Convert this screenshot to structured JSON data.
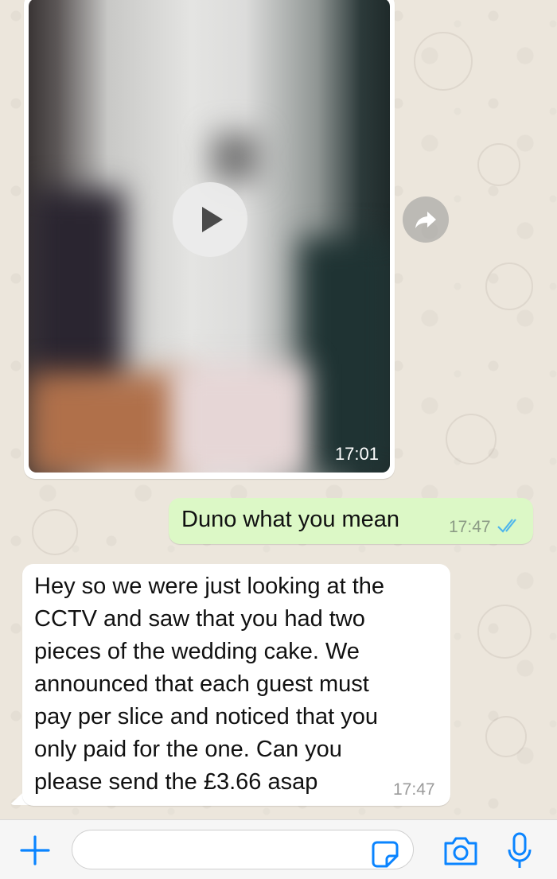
{
  "video_message": {
    "time": "17:01"
  },
  "outgoing_message": {
    "text": "Duno what you mean",
    "time": "17:47"
  },
  "incoming_message": {
    "text": "Hey so we were just looking at the\nCCTV and saw that you had two\npieces of the wedding cake. We\nannounced that each guest must\npay per slice and noticed that you\nonly paid for the one. Can you\nplease send the £3.66 asap",
    "time": "17:47"
  },
  "input_bar": {
    "placeholder": ""
  },
  "colors": {
    "chat_background": "#ece6dc",
    "outgoing_bubble": "#dcf8c6",
    "incoming_bubble": "#ffffff",
    "accent": "#0a84ff",
    "read_ticks": "#4fb6ec"
  },
  "icons": [
    "play-icon",
    "forward-icon",
    "read-ticks-icon",
    "plus-icon",
    "sticker-icon",
    "camera-icon",
    "mic-icon"
  ]
}
